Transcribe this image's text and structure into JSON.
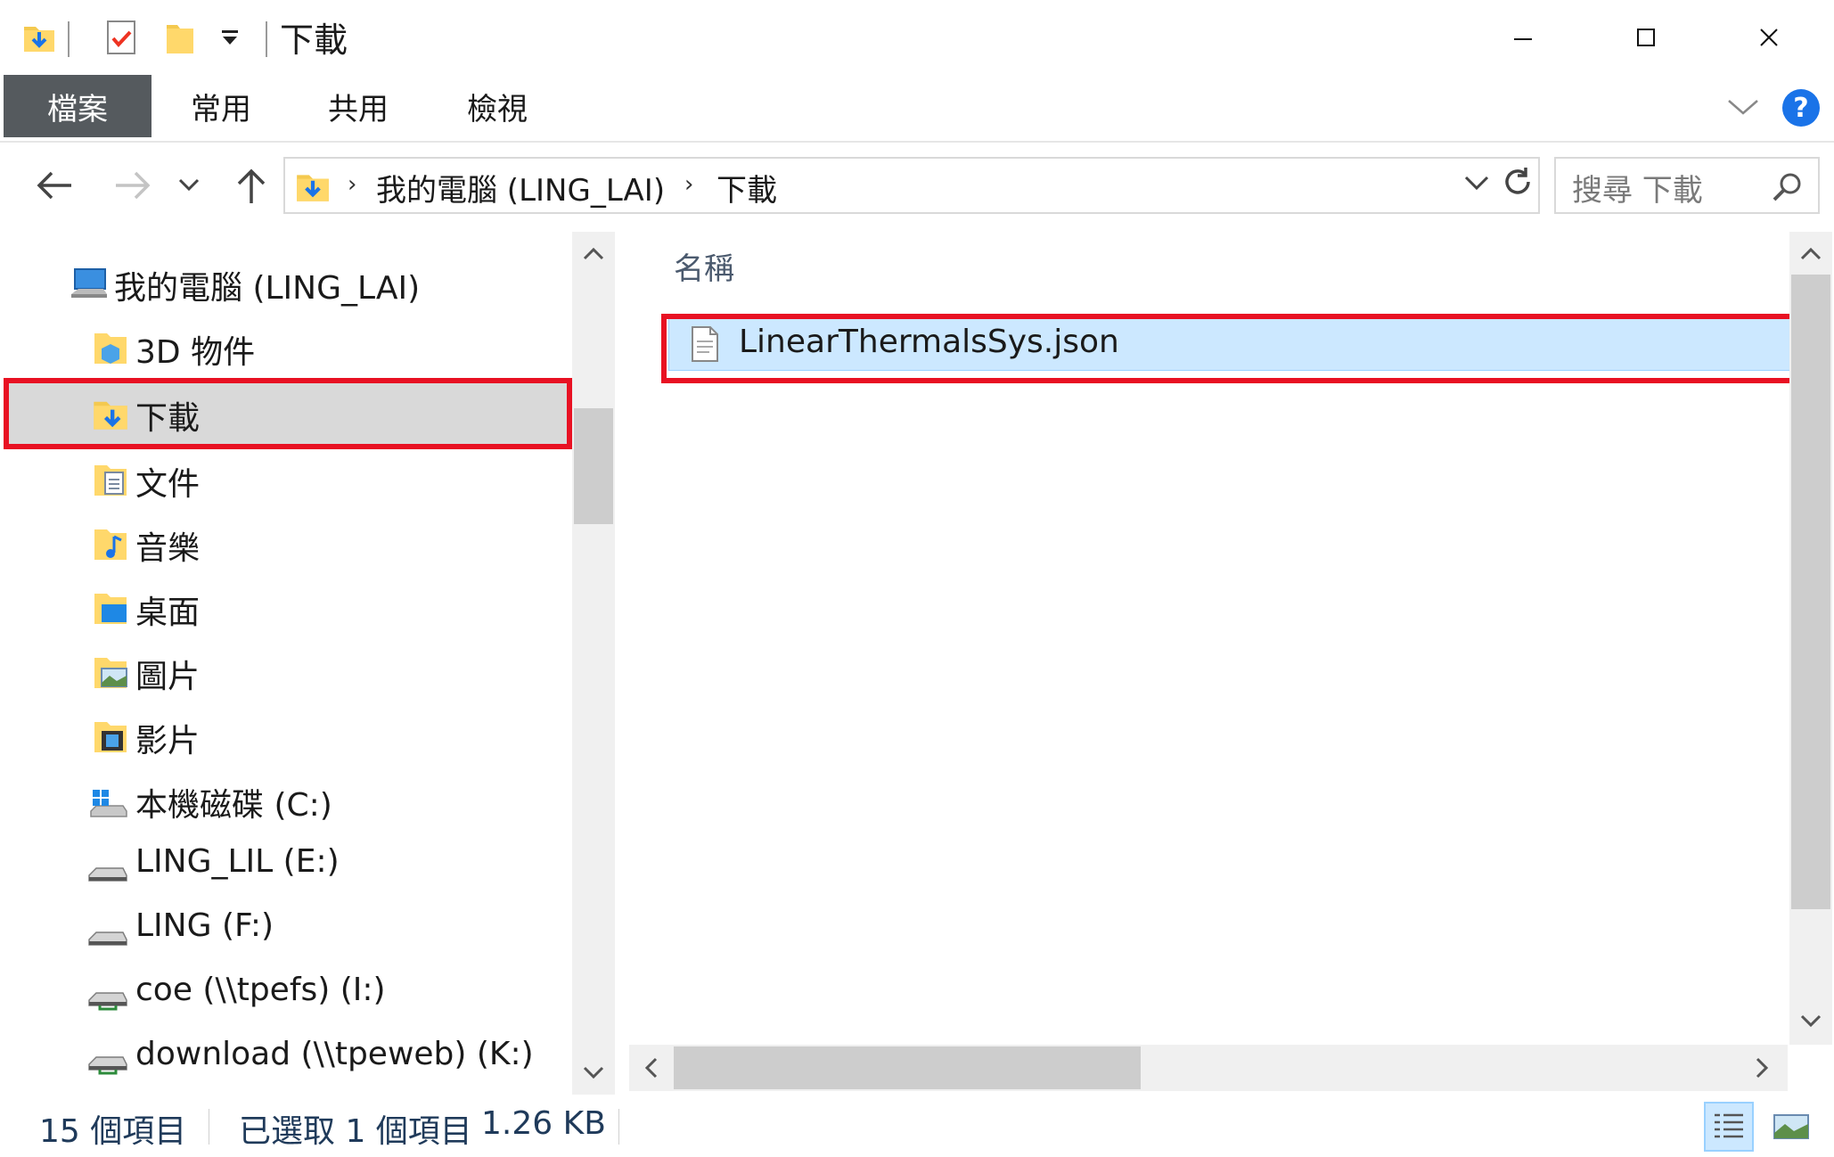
{
  "window": {
    "title": "下載",
    "controls": {
      "minimize_icon": "minimize-icon",
      "maximize_icon": "maximize-icon",
      "close_icon": "close-icon"
    }
  },
  "ribbon": {
    "tabs": [
      {
        "label": "檔案",
        "active": true
      },
      {
        "label": "常用"
      },
      {
        "label": "共用"
      },
      {
        "label": "檢視"
      }
    ],
    "help_label": "?"
  },
  "address": {
    "segments": [
      "我的電腦 (LING_LAI)",
      "下載"
    ],
    "search_placeholder": "搜尋 下載"
  },
  "navpane": {
    "items": [
      {
        "label": "我的電腦 (LING_LAI)",
        "icon": "computer-icon"
      },
      {
        "label": "3D 物件",
        "icon": "3d-objects-folder-icon"
      },
      {
        "label": "下載",
        "icon": "downloads-folder-icon",
        "selected": true
      },
      {
        "label": "文件",
        "icon": "documents-folder-icon"
      },
      {
        "label": "音樂",
        "icon": "music-folder-icon"
      },
      {
        "label": "桌面",
        "icon": "desktop-folder-icon"
      },
      {
        "label": "圖片",
        "icon": "pictures-folder-icon"
      },
      {
        "label": "影片",
        "icon": "videos-folder-icon"
      },
      {
        "label": "本機磁碟 (C:)",
        "icon": "windows-drive-icon"
      },
      {
        "label": "LING_LIL (E:)",
        "icon": "drive-icon"
      },
      {
        "label": "LING (F:)",
        "icon": "drive-icon"
      },
      {
        "label": "coe (\\\\tpefs) (I:)",
        "icon": "network-drive-icon"
      },
      {
        "label": "download (\\\\tpeweb) (K:)",
        "icon": "network-drive-icon"
      }
    ]
  },
  "content": {
    "column_header": "名稱",
    "files": [
      {
        "name": "LinearThermalsSys.json",
        "icon": "json-file-icon",
        "selected": true
      }
    ]
  },
  "status": {
    "item_count": "15 個項目",
    "selection": "已選取 1 個項目",
    "size": "1.26 KB"
  },
  "colors": {
    "highlight_border": "#e81123",
    "selection_fill": "#cce8ff",
    "file_tab": "#555a5e",
    "help_blue": "#1a73e8"
  }
}
